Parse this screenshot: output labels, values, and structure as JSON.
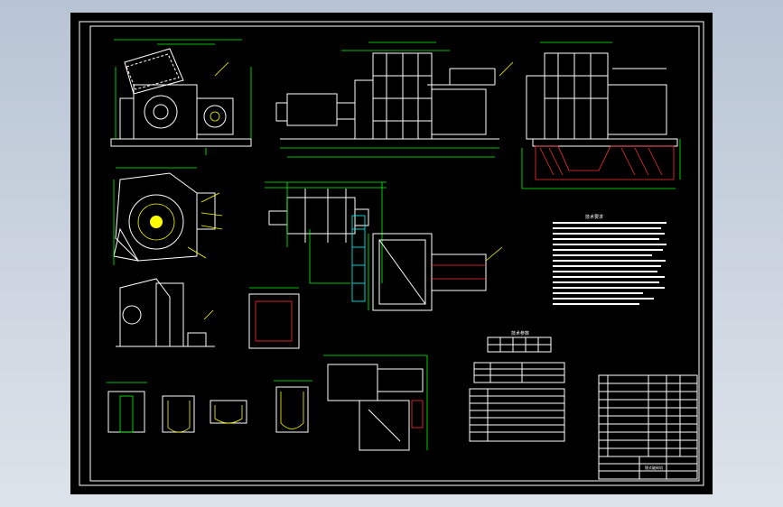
{
  "canvas": {
    "background": "#000000",
    "viewport_background": "#c8d0dc"
  },
  "colors": {
    "lines": "#ffffff",
    "dimensions": "#00ff00",
    "leaders": "#ffff00",
    "hatch": "#ff3030",
    "accent": "#00ffff"
  },
  "notes_title": "技术要求",
  "table_title": "技术参数",
  "title_block": {
    "label": "锤式破碎机"
  }
}
